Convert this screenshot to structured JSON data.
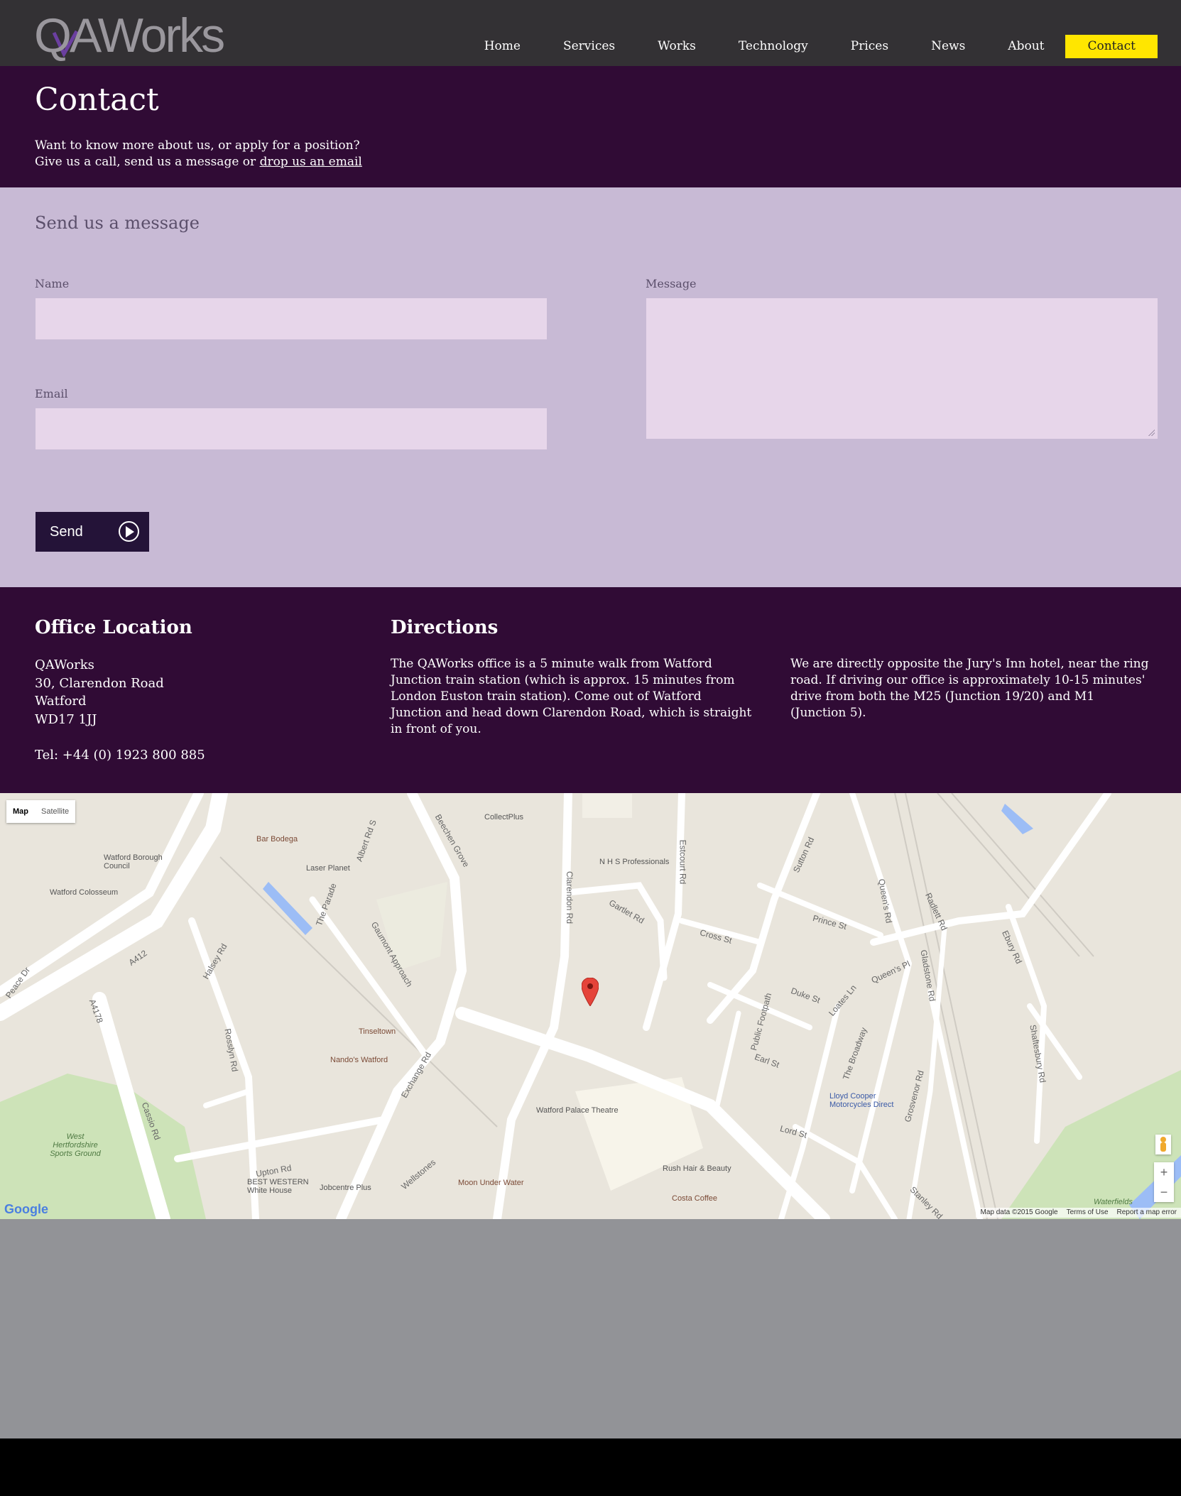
{
  "header": {
    "logo_text": "QAWorks",
    "nav": [
      "Home",
      "Services",
      "Works",
      "Technology",
      "Prices",
      "News",
      "About",
      "Contact"
    ],
    "active": "Contact",
    "accent": "#ffe600"
  },
  "intro": {
    "title": "Contact",
    "line1": "Want to know more about us, or apply for a position?",
    "line2_prefix": "Give us a call, send us a message or ",
    "line2_link": "drop us an email"
  },
  "form": {
    "heading": "Send us a message",
    "name_label": "Name",
    "email_label": "Email",
    "message_label": "Message",
    "name_value": "",
    "email_value": "",
    "message_value": "",
    "send_label": "Send"
  },
  "info": {
    "office_heading": "Office Location",
    "address": [
      "QAWorks",
      "30, Clarendon Road",
      "Watford",
      "WD17 1JJ"
    ],
    "tel": "Tel: +44 (0) 1923 800 885",
    "directions_heading": "Directions",
    "directions_p1": "The QAWorks office is a 5 minute walk from Watford Junction train station (which is approx. 15 minutes from London Euston train station). Come out of Watford Junction and head down Clarendon Road, which is straight in front of you.",
    "directions_p2": "We are directly opposite the Jury's Inn hotel, near the ring road. If driving our office is approximately 10-15 minutes' drive from both the M25 (Junction 19/20) and M1 (Junction 5)."
  },
  "map": {
    "type_options": [
      "Map",
      "Satellite"
    ],
    "selected_type": "Map",
    "labels": [
      "CollectPlus",
      "N H S Professionals",
      "Bar Bodega",
      "Watford Borough Council",
      "Laser Planet",
      "Watford Colosseum",
      "Tinseltown",
      "Nando's Watford",
      "Watford Palace Theatre",
      "Rush Hair & Beauty",
      "Costa Coffee",
      "Moon Under Water",
      "Jobcentre Plus",
      "BEST WESTERN White House",
      "Lloyd Cooper Motorcycles Direct",
      "West Hertfordshire Sports Ground",
      "Waterfields"
    ],
    "roads": [
      "Beechen Grove",
      "Clarendon Rd",
      "Estcourt Rd",
      "Gartlet Rd",
      "Cross St",
      "Sutton Rd",
      "Prince St",
      "Queen's Rd",
      "Radlett Rd",
      "Ebury Rd",
      "Duke St",
      "Loates Ln",
      "Earl St",
      "Lord St",
      "The Broadway",
      "Gladstone Rd",
      "Grosvenor Rd",
      "Shaftesbury Rd",
      "Exchange Rd",
      "Upton Rd",
      "Cassio Rd",
      "Rosslyn Rd",
      "Halsey Rd",
      "A412",
      "A4178",
      "The Parade",
      "Gaumont Approach",
      "Albert Rd S",
      "Stanley Rd",
      "Wellstones",
      "Public Footpath",
      "Queen's Pl",
      "Peace Dr"
    ],
    "attribution": [
      "Map data ©2015 Google",
      "Terms of Use",
      "Report a map error"
    ],
    "google_logo": "Google"
  }
}
